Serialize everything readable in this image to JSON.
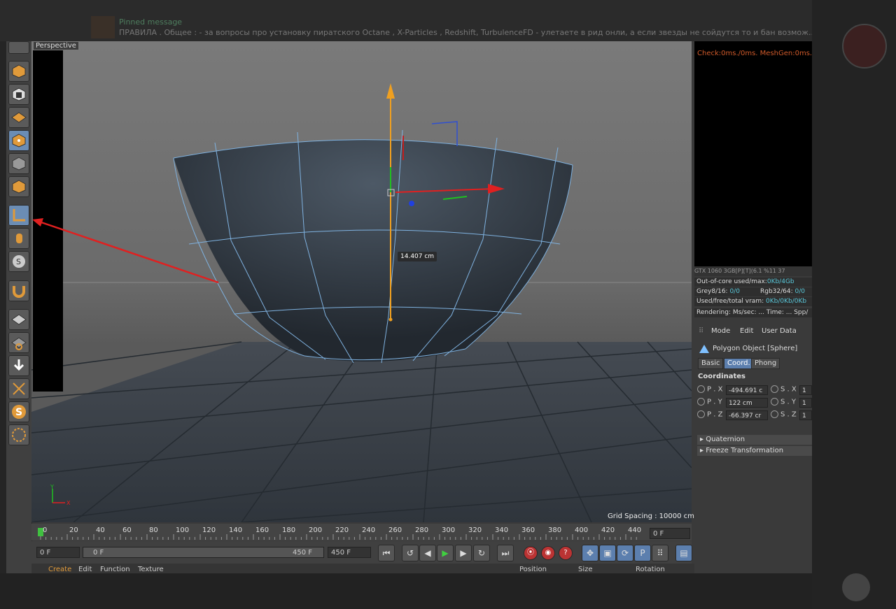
{
  "telegram": {
    "pinned_title": "Pinned message",
    "pinned_text": "ПРАВИЛА . Общее : - за вопросы про установку пиратского Octane , X-Particles , Redshift, TurbulenceFD - улетаете в рид онли, а если звезды не сойдутся то и бан возмож..."
  },
  "viewport": {
    "label": "Perspective",
    "dimension": "14.407 cm",
    "grid_spacing": "Grid Spacing : 10000 cm",
    "axis_y": "Y",
    "axis_x": "X"
  },
  "timeline": {
    "ticks": [
      "0",
      "20",
      "40",
      "60",
      "80",
      "100",
      "120",
      "140",
      "160",
      "180",
      "200",
      "220",
      "240",
      "260",
      "280",
      "300",
      "320",
      "340",
      "360",
      "380",
      "400",
      "420",
      "440"
    ],
    "current_frame": "0 F",
    "start_field": "0 F",
    "range_start": "0 F",
    "range_end": "450 F",
    "end_field": "450 F"
  },
  "bottom_menu": {
    "create": "Create",
    "edit": "Edit",
    "function": "Function",
    "texture": "Texture",
    "position": "Position",
    "size": "Size",
    "rotation": "Rotation"
  },
  "render_panel": {
    "log": "Check:0ms./0ms. MeshGen:0ms. Up",
    "gpu": "GTX 1060 3GB[P][T](6.1      %11      37",
    "out_of_core_label": "Out-of-core used/max:",
    "out_of_core_value": "0Kb/4Gb",
    "grey_label": "Grey8/16: ",
    "grey_value": "0/0",
    "rgb_label": "Rgb32/64: ",
    "rgb_value": "0/0",
    "vram_label": "Used/free/total vram: ",
    "vram_value": "0Kb/0Kb/0Kb",
    "rendering": "Rendering:      Ms/sec: ...   Time: ...  Spp/"
  },
  "attributes": {
    "menu": [
      "Mode",
      "Edit",
      "User Data"
    ],
    "object_title": "Polygon Object [Sphere]",
    "tabs": [
      "Basic",
      "Coord.",
      "Phong"
    ],
    "active_tab": "Coord.",
    "coordinates_header": "Coordinates",
    "rows": [
      {
        "p_label": "P . X",
        "p_value": "-494.691 c",
        "s_label": "S . X",
        "s_value": "1"
      },
      {
        "p_label": "P . Y",
        "p_value": "122 cm",
        "s_label": "S . Y",
        "s_value": "1"
      },
      {
        "p_label": "P . Z",
        "p_value": "-66.397 cr",
        "s_label": "S . Z",
        "s_value": "1"
      }
    ],
    "quaternion": "Quaternion",
    "freeze": "Freeze Transformation"
  },
  "colors": {
    "accent_blue": "#5c7fae",
    "gizmo_orange": "#f0a020",
    "wire_blue": "#7fb2e0",
    "arrow_red": "#e02020"
  }
}
